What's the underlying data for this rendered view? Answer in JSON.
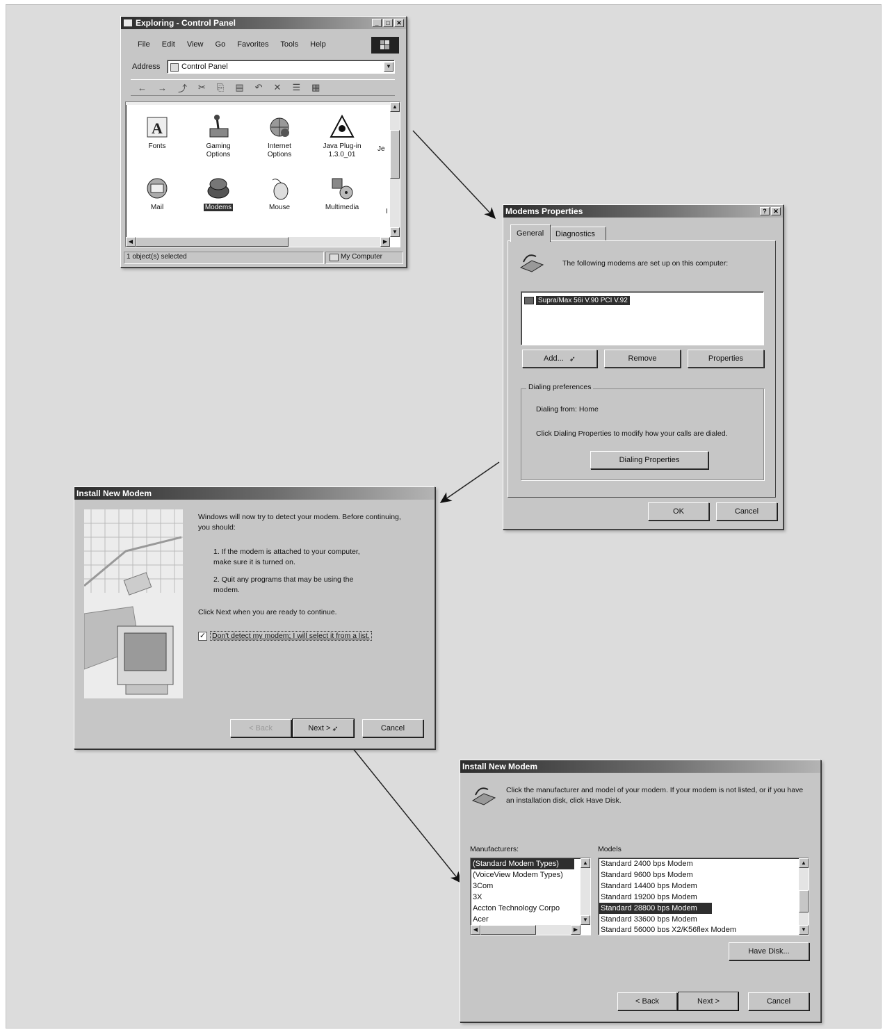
{
  "explorer": {
    "title": "Exploring - Control Panel",
    "menu": [
      "File",
      "Edit",
      "View",
      "Go",
      "Favorites",
      "Tools",
      "Help"
    ],
    "address_label": "Address",
    "address_value": "Control Panel",
    "icons": [
      {
        "label": "Fonts",
        "icon": "fonts-icon"
      },
      {
        "label": "Gaming Options",
        "icon": "gaming-options-icon"
      },
      {
        "label": "Internet Options",
        "icon": "internet-options-icon"
      },
      {
        "label": "Java Plug-in 1.3.0_01",
        "icon": "java-plugin-icon"
      },
      {
        "label": "Mail",
        "icon": "mail-icon"
      },
      {
        "label": "Modems",
        "icon": "modems-icon",
        "selected": true
      },
      {
        "label": "Mouse",
        "icon": "mouse-icon"
      },
      {
        "label": "Multimedia",
        "icon": "multimedia-icon"
      }
    ],
    "status_left": "1 object(s) selected",
    "status_right": "My Computer"
  },
  "modems_props": {
    "title": "Modems Properties",
    "tabs": [
      "General",
      "Diagnostics"
    ],
    "intro": "The following modems are set up on this computer:",
    "modem_item": "Supra/Max 56i V.90 PCI V.92",
    "buttons": {
      "add": "Add...",
      "remove": "Remove",
      "properties": "Properties"
    },
    "dialing_group": "Dialing preferences",
    "dialing_from": "Dialing from:  Home",
    "dialing_help": "Click Dialing Properties to modify how your calls are dialed.",
    "dialing_button": "Dialing Properties",
    "ok": "OK",
    "cancel": "Cancel"
  },
  "install1": {
    "title": "Install New Modem",
    "intro": "Windows will now try to detect your modem.  Before continuing, you should:",
    "step1": "1.  If the modem is attached to your computer, make sure it is turned on.",
    "step2": "2.  Quit any programs that may be using the modem.",
    "click_next": "Click Next when you are ready to continue.",
    "checkbox_label": "Don't detect my modem; I will select it from a list.",
    "checkbox_checked": true,
    "back": "< Back",
    "next": "Next >",
    "cancel": "Cancel"
  },
  "install2": {
    "title": "Install New Modem",
    "intro": "Click the manufacturer and model of your modem. If your modem is not listed, or if you have an installation disk, click Have Disk.",
    "manufacturers_label": "Manufacturers:",
    "manufacturers": [
      "(Standard Modem Types)",
      "(VoiceView Modem Types)",
      "3Com",
      "3X",
      "Accton Technology Corpo",
      "Acer"
    ],
    "models_label": "Models",
    "models": [
      "Standard  2400 bps Modem",
      "Standard  9600 bps Modem",
      "Standard 14400 bps Modem",
      "Standard 19200 bps Modem",
      "Standard 28800 bps Modem",
      "Standard 33600 bps Modem",
      "Standard 56000 bps X2/K56flex Modem"
    ],
    "selected_model_index": 4,
    "have_disk": "Have Disk...",
    "back": "< Back",
    "next": "Next >",
    "cancel": "Cancel"
  }
}
